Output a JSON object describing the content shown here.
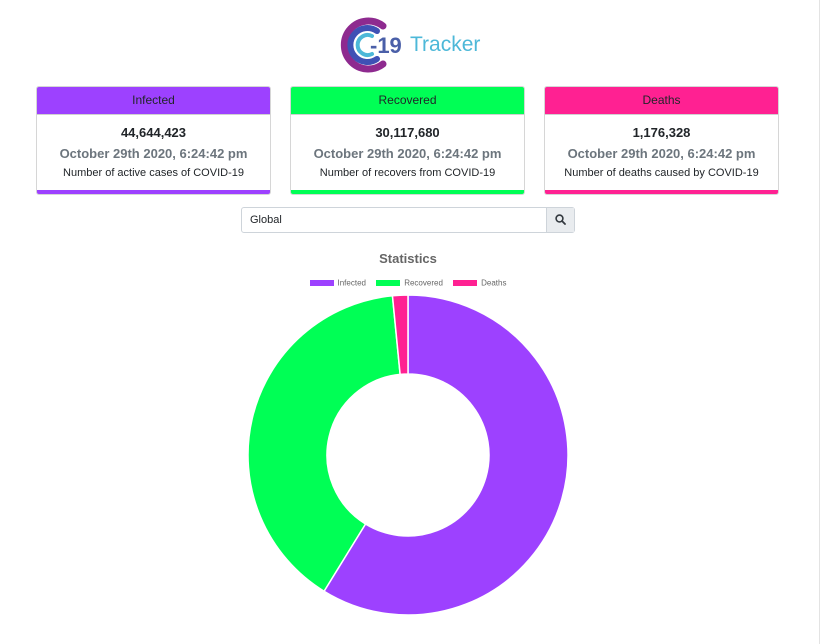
{
  "logo": {
    "mark": "C",
    "number": "-19",
    "word": "Tracker",
    "colors": {
      "outer": "#8e2a8f",
      "inner": "#3f51b5",
      "accent": "#4db8d8"
    }
  },
  "cards": [
    {
      "title": "Infected",
      "count": "44,644,423",
      "date": "October 29th 2020, 6:24:42 pm",
      "description": "Number of active cases of COVID-19",
      "color": "#9d41ff"
    },
    {
      "title": "Recovered",
      "count": "30,117,680",
      "date": "October 29th 2020, 6:24:42 pm",
      "description": "Number of recovers from COVID-19",
      "color": "#00ff55"
    },
    {
      "title": "Deaths",
      "count": "1,176,328",
      "date": "October 29th 2020, 6:24:42 pm",
      "description": "Number of deaths caused by COVID-19",
      "color": "#ff2192"
    }
  ],
  "search": {
    "value": "Global",
    "button_icon": "search-icon"
  },
  "chart_data": {
    "type": "pie",
    "title": "Statistics",
    "legend_position": "top",
    "categories": [
      "Infected",
      "Recovered",
      "Deaths"
    ],
    "values": [
      44644423,
      30117680,
      1176328
    ],
    "colors": [
      "#9d41ff",
      "#00ff55",
      "#ff2192"
    ],
    "donut": true
  }
}
